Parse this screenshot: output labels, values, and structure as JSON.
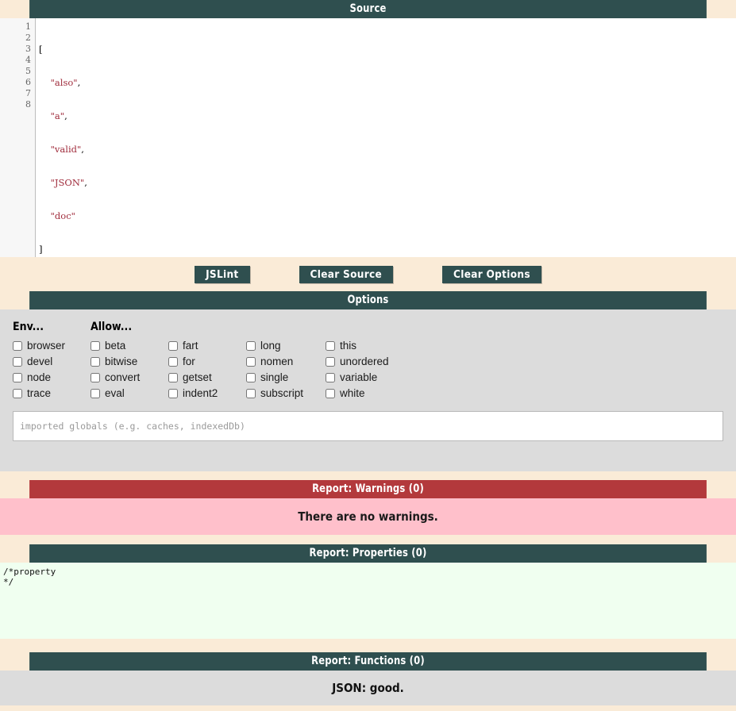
{
  "source": {
    "header": "Source",
    "line_numbers": [
      "1",
      "2",
      "3",
      "4",
      "5",
      "6",
      "7",
      "8"
    ],
    "active_line": 8,
    "lines": [
      {
        "n": "1",
        "punc_before": "[",
        "str": "",
        "punc_after": ""
      },
      {
        "n": "2",
        "punc_before": "    ",
        "str": "\"also\"",
        "punc_after": ","
      },
      {
        "n": "3",
        "punc_before": "    ",
        "str": "\"a\"",
        "punc_after": ","
      },
      {
        "n": "4",
        "punc_before": "    ",
        "str": "\"valid\"",
        "punc_after": ","
      },
      {
        "n": "5",
        "punc_before": "    ",
        "str": "\"JSON\"",
        "punc_after": ","
      },
      {
        "n": "6",
        "punc_before": "    ",
        "str": "\"doc\"",
        "punc_after": ""
      },
      {
        "n": "7",
        "punc_before": "]",
        "str": "",
        "punc_after": ""
      },
      {
        "n": "8",
        "punc_before": "",
        "str": "",
        "punc_after": ""
      }
    ]
  },
  "toolbar": {
    "jslint_label": "JSLint",
    "clear_source_label": "Clear Source",
    "clear_options_label": "Clear Options"
  },
  "options": {
    "header": "Options",
    "columns": [
      {
        "title": "Env...",
        "items": [
          {
            "label": "browser",
            "checked": false
          },
          {
            "label": "devel",
            "checked": false
          },
          {
            "label": "node",
            "checked": false
          },
          {
            "label": "trace",
            "checked": false
          }
        ]
      },
      {
        "title": "Allow...",
        "items": [
          {
            "label": "beta",
            "checked": false
          },
          {
            "label": "bitwise",
            "checked": false
          },
          {
            "label": "convert",
            "checked": false
          },
          {
            "label": "eval",
            "checked": false
          }
        ]
      },
      {
        "title": "",
        "items": [
          {
            "label": "fart",
            "checked": false
          },
          {
            "label": "for",
            "checked": false
          },
          {
            "label": "getset",
            "checked": false
          },
          {
            "label": "indent2",
            "checked": false
          }
        ]
      },
      {
        "title": "",
        "items": [
          {
            "label": "long",
            "checked": false
          },
          {
            "label": "nomen",
            "checked": false
          },
          {
            "label": "single",
            "checked": false
          },
          {
            "label": "subscript",
            "checked": false
          }
        ]
      },
      {
        "title": "",
        "items": [
          {
            "label": "this",
            "checked": false
          },
          {
            "label": "unordered",
            "checked": false
          },
          {
            "label": "variable",
            "checked": false
          },
          {
            "label": "white",
            "checked": false
          }
        ]
      }
    ],
    "globals": {
      "value": "",
      "placeholder": "imported globals (e.g. caches, indexedDb)"
    }
  },
  "reports": {
    "warnings": {
      "header": "Report: Warnings (0)",
      "count": 0,
      "message": "There are no warnings."
    },
    "properties": {
      "header": "Report: Properties (0)",
      "count": 0,
      "body": "/*property\n*/"
    },
    "functions": {
      "header": "Report: Functions (0)",
      "count": 0,
      "message": "JSON: good."
    }
  },
  "colors": {
    "header_teal": "#2f4f4f",
    "warning_red": "#b3393c",
    "warning_pink": "#ffc0cb",
    "property_mint": "#f0fff0",
    "page_cream": "#faebd7",
    "panel_gray": "#dcdcdc",
    "string_red": "#a02c3c"
  }
}
